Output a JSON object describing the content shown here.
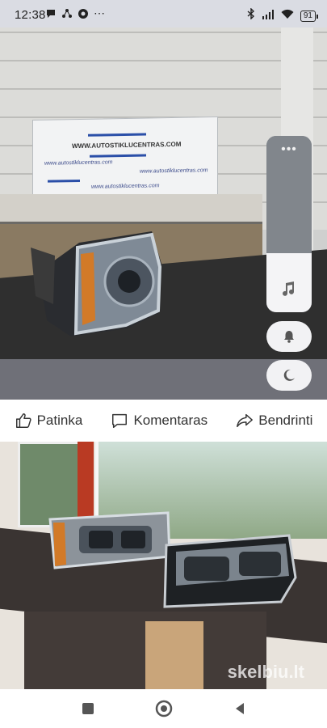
{
  "status_bar": {
    "time": "12:38",
    "more": "⋯",
    "battery": "91"
  },
  "photo1": {
    "banner_main": "WWW.AUTOSTIKLUCENTRAS.COM",
    "banner_small_1": "www.autostiklucentras.com",
    "banner_small_2": "www.autostiklucentras.com",
    "banner_small_3": "www.autostiklucentras.com"
  },
  "side_panel": {
    "more": "•••"
  },
  "actions": {
    "like": "Patinka",
    "comment": "Komentaras",
    "share": "Bendrinti"
  },
  "photo2": {
    "watermark": "skelbiu.lt"
  },
  "colors": {
    "status_bg": "#dadce3",
    "panel": "#81868c"
  }
}
